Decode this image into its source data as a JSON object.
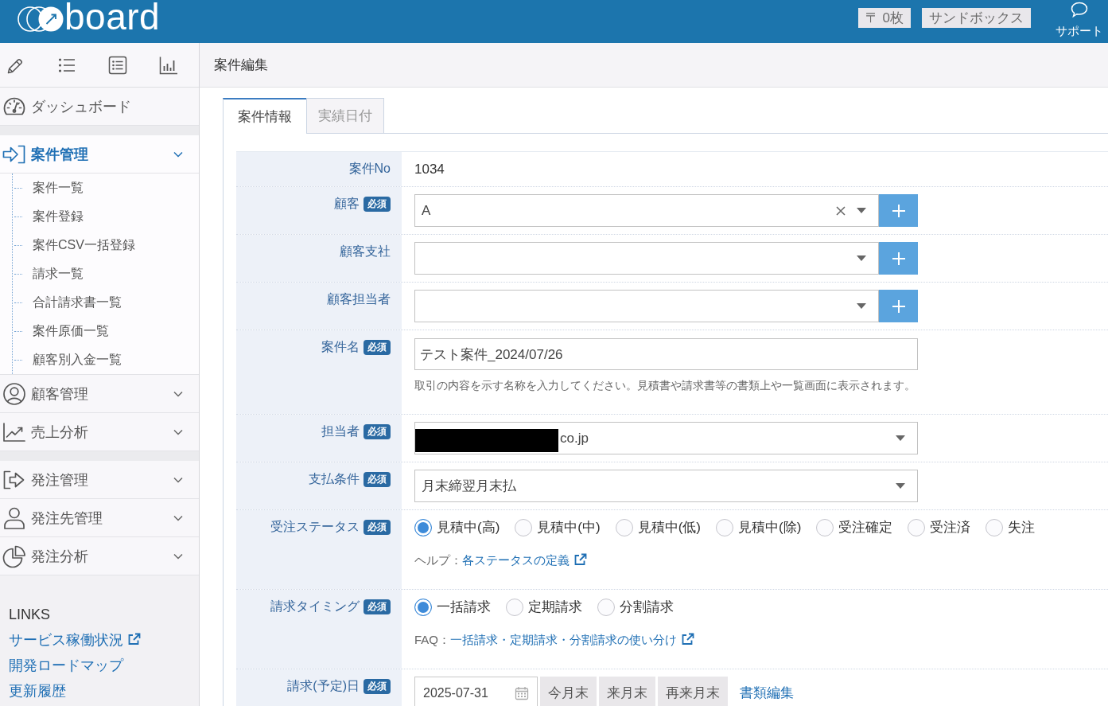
{
  "header": {
    "logo": "board",
    "buttons": [
      "〒 0枚",
      "サンドボックス"
    ],
    "support": "サポート"
  },
  "sidebar": {
    "groups": [
      [
        {
          "label": "ダッシュボード",
          "selected": false
        }
      ],
      [
        {
          "label": "案件管理",
          "selected": true,
          "expanded": true,
          "children": [
            {
              "label": "案件一覧",
              "selected": false
            },
            {
              "label": "案件登録",
              "selected": false
            },
            {
              "label": "案件CSV一括登録",
              "selected": false
            },
            {
              "label": "請求一覧",
              "selected": false
            },
            {
              "label": "合計請求書一覧",
              "selected": false
            },
            {
              "label": "案件原価一覧",
              "selected": false
            },
            {
              "label": "顧客別入金一覧",
              "selected": false
            }
          ]
        },
        {
          "label": "顧客管理",
          "selected": false,
          "expanded": false
        },
        {
          "label": "売上分析",
          "selected": false,
          "expanded": false
        }
      ],
      [
        {
          "label": "発注管理",
          "selected": false,
          "expanded": false
        },
        {
          "label": "発注先管理",
          "selected": false,
          "expanded": false
        },
        {
          "label": "発注分析",
          "selected": false,
          "expanded": false
        }
      ]
    ],
    "links_title": "LINKS",
    "links": [
      {
        "label": "サービス稼働状況",
        "external": true
      },
      {
        "label": "開発ロードマップ",
        "external": false
      },
      {
        "label": "更新履歴",
        "external": false
      }
    ]
  },
  "page_title": "案件編集",
  "tabs": [
    {
      "label": "案件情報",
      "selected": true
    },
    {
      "label": "実績日付",
      "selected": false
    }
  ],
  "form": {
    "rows": [
      {
        "kind": "text",
        "label": "案件No",
        "value": "1034"
      },
      {
        "kind": "select",
        "label": "顧客",
        "badge": "必須",
        "value": "A",
        "clearable": true,
        "addable": true,
        "redacted": false
      },
      {
        "kind": "select",
        "label": "顧客支社",
        "clearable": false,
        "addable": true,
        "redacted": false
      },
      {
        "kind": "select",
        "label": "顧客担当者",
        "clearable": false,
        "addable": true,
        "redacted": false
      },
      {
        "kind": "input",
        "label": "案件名",
        "badge": "必須",
        "value": "テスト案件_2024/07/26",
        "help": "取引の内容を示す名称を入力してください。見積書や請求書等の書類上や一覧画面に表示されます。"
      },
      {
        "kind": "select",
        "label": "担当者",
        "badge": "必須",
        "value": "co.jp",
        "clearable": false,
        "addable": false,
        "redacted": true
      },
      {
        "kind": "select",
        "label": "支払条件",
        "badge": "必須",
        "value": "月末締翌月末払",
        "clearable": false,
        "addable": false,
        "redacted": false
      },
      {
        "kind": "radio",
        "label": "受注ステータス",
        "badge": "必須",
        "options": [
          {
            "label": "見積中(高)",
            "selected": true
          },
          {
            "label": "見積中(中)",
            "selected": false
          },
          {
            "label": "見積中(低)",
            "selected": false
          },
          {
            "label": "見積中(除)",
            "selected": false
          },
          {
            "label": "受注確定",
            "selected": false
          },
          {
            "label": "受注済",
            "selected": false
          },
          {
            "label": "失注",
            "selected": false
          }
        ],
        "note": {
          "prefix": "ヘルプ：",
          "link": "各ステータスの定義",
          "external": true
        }
      },
      {
        "kind": "radio",
        "label": "請求タイミング",
        "badge": "必須",
        "options": [
          {
            "label": "一括請求",
            "selected": true
          },
          {
            "label": "定期請求",
            "selected": false
          },
          {
            "label": "分割請求",
            "selected": false
          }
        ],
        "note": {
          "prefix": "FAQ：",
          "link": "一括請求・定期請求・分割請求の使い分け",
          "external": true
        }
      },
      {
        "kind": "date",
        "label": "請求(予定)日",
        "badge": "必須",
        "value": "2025-07-31",
        "buttons": [
          "今月末",
          "来月末",
          "再来月末"
        ],
        "link": "書類編集"
      }
    ]
  }
}
